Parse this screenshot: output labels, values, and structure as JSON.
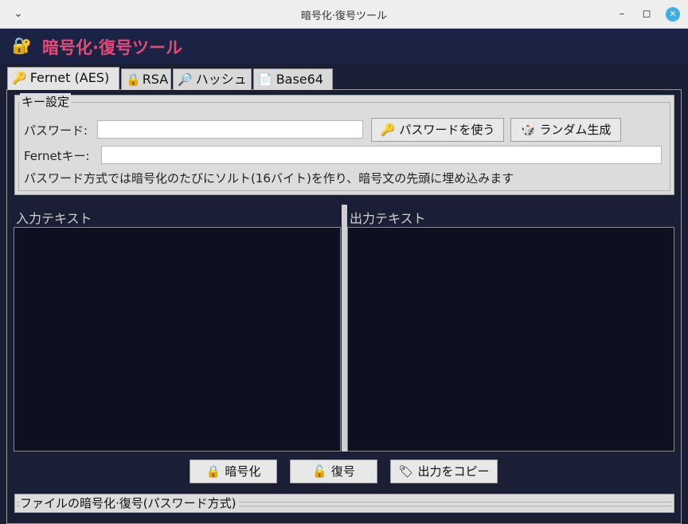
{
  "window": {
    "title": "暗号化·復号ツール",
    "menu_icon": "chevron-down-icon",
    "minimize_glyph": "–",
    "maximize_glyph": "◻",
    "close_glyph": "✕"
  },
  "header": {
    "icon": "🔐",
    "title": "暗号化·復号ツール",
    "title_color": "#e84a78"
  },
  "tabs": [
    {
      "icon": "🔑",
      "label": "Fernet (AES)",
      "active": true
    },
    {
      "icon": "🔒",
      "label": "RSA",
      "active": false
    },
    {
      "icon": "🔎",
      "label": "ハッシュ",
      "active": false
    },
    {
      "icon": "📄",
      "label": "Base64",
      "active": false
    }
  ],
  "key_settings": {
    "legend": "キー設定",
    "password_label": "パスワード:",
    "password_value": "",
    "use_password_button": {
      "icon": "🔑",
      "label": "パスワードを使う"
    },
    "random_button": {
      "icon": "🎲",
      "label": "ランダム生成"
    },
    "fernet_key_label": "Fernetキー:",
    "fernet_key_value": "",
    "hint": "パスワード方式では暗号化のたびにソルト(16バイト)を作り、暗号文の先頭に埋め込みます"
  },
  "input_pane": {
    "label": "入力テキスト",
    "value": ""
  },
  "output_pane": {
    "label": "出力テキスト",
    "value": ""
  },
  "actions": [
    {
      "icon": "🔒",
      "label": "暗号化"
    },
    {
      "icon": "🔓",
      "label": "復号"
    },
    {
      "icon": "🏷",
      "label": "出力をコピー"
    }
  ],
  "file_section": {
    "legend": "ファイルの暗号化·復号(パスワード方式)"
  }
}
